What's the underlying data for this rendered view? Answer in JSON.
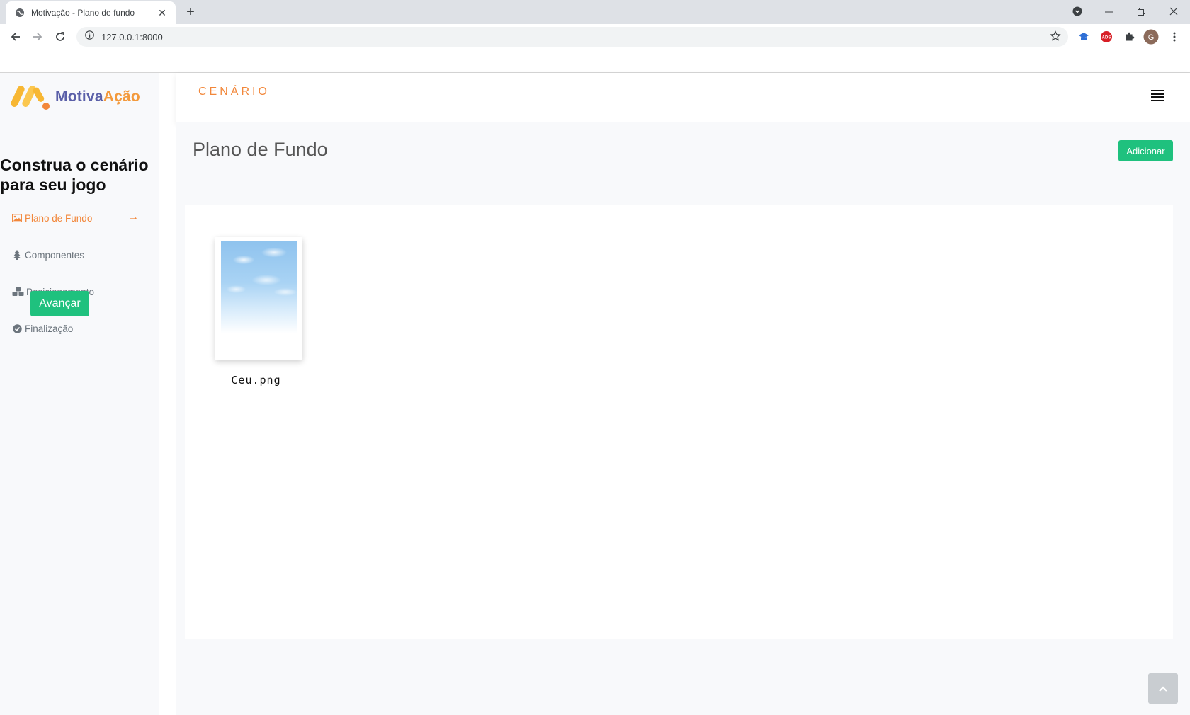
{
  "browser": {
    "tab_title": "Motivação - Plano de fundo",
    "tab_close": "✕",
    "new_tab": "+",
    "url": "127.0.0.1:8000",
    "profile_initial": "G",
    "ext_ads_label": "ADS"
  },
  "app": {
    "logo_part1": "Motiva",
    "logo_part2": "Ação",
    "header_title": "CENÁRIO"
  },
  "sidebar": {
    "heading": "Construa o cenário para seu jogo",
    "items": [
      {
        "label": "Plano de Fundo",
        "icon": "image-icon",
        "active": true
      },
      {
        "label": "Componentes",
        "icon": "tree-icon",
        "active": false
      },
      {
        "label": "Posicionamento",
        "icon": "cubes-icon",
        "active": false
      },
      {
        "label": "Finalização",
        "icon": "check-circle-icon",
        "active": false
      }
    ],
    "active_arrow": "→",
    "next_button": "Avançar"
  },
  "main": {
    "title": "Plano de Fundo",
    "add_button": "Adicionar",
    "files": [
      {
        "name": "Ceu.png"
      }
    ]
  },
  "colors": {
    "accent_orange": "#f2873a",
    "accent_green": "#1fc17e",
    "logo_purple": "#5a5fa8"
  }
}
